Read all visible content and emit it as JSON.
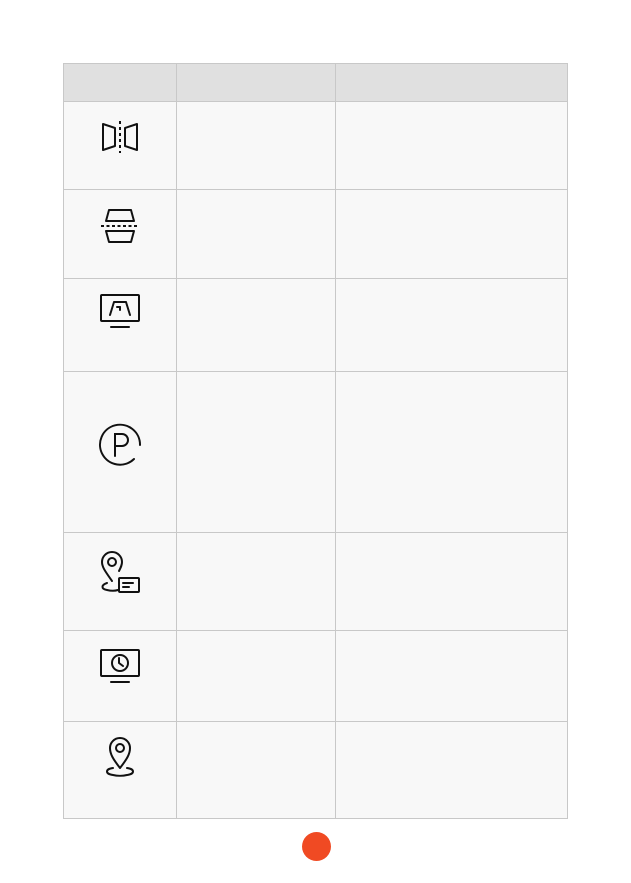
{
  "table": {
    "headers": [
      "",
      "",
      ""
    ],
    "rows": [
      {
        "icon": "mirror-fold-icon",
        "name": "",
        "description": ""
      },
      {
        "icon": "split-view-icon",
        "name": "",
        "description": ""
      },
      {
        "icon": "display-road-icon",
        "name": "",
        "description": ""
      },
      {
        "icon": "parking-icon",
        "name": "",
        "description": ""
      },
      {
        "icon": "location-card-icon",
        "name": "",
        "description": ""
      },
      {
        "icon": "display-clock-icon",
        "name": "",
        "description": ""
      },
      {
        "icon": "location-pin-icon",
        "name": "",
        "description": ""
      }
    ]
  },
  "colors": {
    "header_bg": "#e0e0e0",
    "row_bg": "#f8f8f8",
    "border": "#c8c8c8",
    "icon_stroke": "#111111",
    "page_dot": "#f04a23"
  }
}
